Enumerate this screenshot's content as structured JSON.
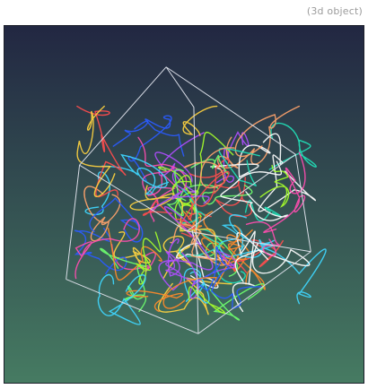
{
  "caption": "(3d object)",
  "viewport": {
    "background_top": "#222742",
    "background_bottom": "#467b62",
    "cube_edge_color": "#d9dde6",
    "curve_colors": [
      "#ff4d4d",
      "#ffd23f",
      "#6eff6e",
      "#3fd7ff",
      "#b04dff",
      "#ff8a2a",
      "#ffffff",
      "#2a5bff",
      "#ff4db0",
      "#a6ff2a",
      "#22e0b7",
      "#ffa36b"
    ],
    "curve_count": 70
  }
}
